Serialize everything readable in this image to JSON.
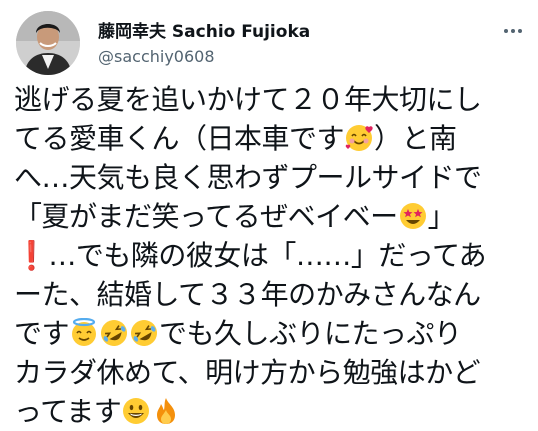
{
  "user": {
    "display_name": "藤岡幸夫 Sachio Fujioka",
    "handle": "@sacchiy0608"
  },
  "tweet": {
    "line1": "逃げる夏を追いかけて２０年大切にし",
    "line2a": "てる愛車くん（日本車です",
    "line2b": "）と南",
    "line3": "へ…天気も良く思わずプールサイドで",
    "line4a": "「夏がまだ笑ってるぜベイベー",
    "line4b": "」",
    "line5a": "❗",
    "line5b": "…でも隣の彼女は「……」だってあ",
    "line6": "ーた、結婚して３３年のかみさんなん",
    "line7a": "です",
    "line7b": "でも久しぶりにたっぷり",
    "line8": "カラダ休めて、明け方から勉強はかど",
    "line9": "ってます"
  },
  "icons": {
    "more": "more-options-icon",
    "emoji_hearts": "smiling-face-with-hearts-emoji",
    "emoji_starstruck": "star-struck-emoji",
    "emoji_halo": "smiling-face-with-halo-emoji",
    "emoji_rofl": "rolling-on-floor-laughing-emoji",
    "emoji_grin": "grinning-face-emoji",
    "emoji_fire": "fire-emoji"
  },
  "colors": {
    "text": "#0f1419",
    "secondary": "#536471",
    "emoji_yellow": "#ffcc33",
    "exclamation": "#e0245e"
  }
}
